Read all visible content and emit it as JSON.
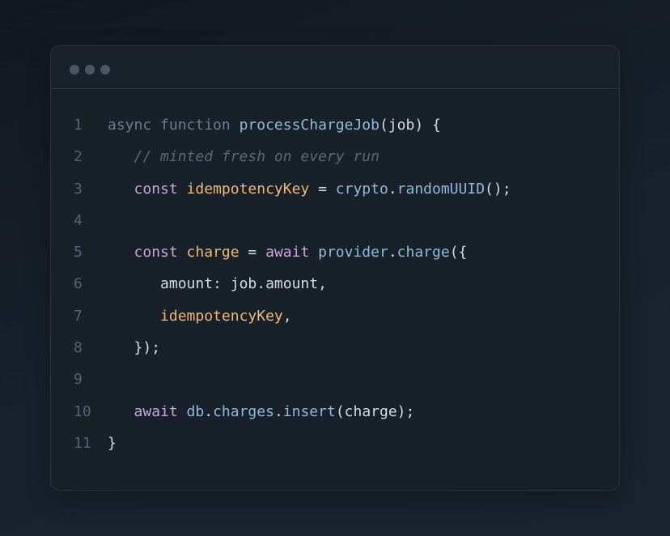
{
  "window": {
    "traffic_lights": [
      "dot",
      "dot",
      "dot"
    ]
  },
  "code": {
    "lines": [
      {
        "number": "1",
        "indent": "",
        "tokens": [
          {
            "t": "async",
            "c": "kw"
          },
          {
            "t": " ",
            "c": "pl"
          },
          {
            "t": "function",
            "c": "kw"
          },
          {
            "t": " ",
            "c": "pl"
          },
          {
            "t": "processChargeJob",
            "c": "fn"
          },
          {
            "t": "(job) {",
            "c": "pl"
          }
        ]
      },
      {
        "number": "2",
        "indent": "   ",
        "tokens": [
          {
            "t": "// minted fresh on every run",
            "c": "cm"
          }
        ]
      },
      {
        "number": "3",
        "indent": "   ",
        "tokens": [
          {
            "t": "const",
            "c": "kw2"
          },
          {
            "t": " ",
            "c": "pl"
          },
          {
            "t": "idempotencyKey",
            "c": "var"
          },
          {
            "t": " = ",
            "c": "pl"
          },
          {
            "t": "crypto",
            "c": "fn"
          },
          {
            "t": ".",
            "c": "pl"
          },
          {
            "t": "randomUUID",
            "c": "fn"
          },
          {
            "t": "();",
            "c": "pl"
          }
        ]
      },
      {
        "number": "4",
        "indent": "",
        "tokens": []
      },
      {
        "number": "5",
        "indent": "   ",
        "tokens": [
          {
            "t": "const",
            "c": "kw2"
          },
          {
            "t": " ",
            "c": "pl"
          },
          {
            "t": "charge",
            "c": "var"
          },
          {
            "t": " = ",
            "c": "pl"
          },
          {
            "t": "await",
            "c": "kw2"
          },
          {
            "t": " ",
            "c": "pl"
          },
          {
            "t": "provider",
            "c": "fn"
          },
          {
            "t": ".",
            "c": "pl"
          },
          {
            "t": "charge",
            "c": "fn"
          },
          {
            "t": "({",
            "c": "pl"
          }
        ]
      },
      {
        "number": "6",
        "indent": "      ",
        "tokens": [
          {
            "t": "amount: job.amount,",
            "c": "pl"
          }
        ]
      },
      {
        "number": "7",
        "indent": "      ",
        "tokens": [
          {
            "t": "idempotencyKey",
            "c": "var"
          },
          {
            "t": ",",
            "c": "pl"
          }
        ]
      },
      {
        "number": "8",
        "indent": "   ",
        "tokens": [
          {
            "t": "});",
            "c": "pl"
          }
        ]
      },
      {
        "number": "9",
        "indent": "",
        "tokens": []
      },
      {
        "number": "10",
        "indent": "   ",
        "tokens": [
          {
            "t": "await",
            "c": "kw2"
          },
          {
            "t": " ",
            "c": "pl"
          },
          {
            "t": "db",
            "c": "fn"
          },
          {
            "t": ".",
            "c": "pl"
          },
          {
            "t": "charges",
            "c": "fn"
          },
          {
            "t": ".",
            "c": "pl"
          },
          {
            "t": "insert",
            "c": "fn"
          },
          {
            "t": "(charge);",
            "c": "pl"
          }
        ]
      },
      {
        "number": "11",
        "indent": "",
        "tokens": [
          {
            "t": "}",
            "c": "pl"
          }
        ]
      }
    ]
  },
  "colors": {
    "background": "#141b23",
    "panel": "#18202a",
    "keyword": "#6f7c8b",
    "keyword_control": "#c9a8dc",
    "function": "#8fbcd9",
    "variable": "#f0b978",
    "comment": "#5d6876",
    "text": "#d5dce4",
    "line_number": "#566270"
  }
}
